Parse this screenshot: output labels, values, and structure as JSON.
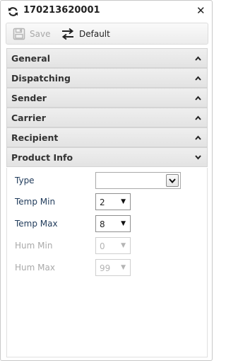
{
  "window": {
    "title": "170213620001"
  },
  "toolbar": {
    "save_label": "Save",
    "default_label": "Default"
  },
  "sections": [
    {
      "label": "General",
      "expanded": false
    },
    {
      "label": "Dispatching",
      "expanded": false
    },
    {
      "label": "Sender",
      "expanded": false
    },
    {
      "label": "Carrier",
      "expanded": false
    },
    {
      "label": "Recipient",
      "expanded": false
    },
    {
      "label": "Product Info",
      "expanded": true
    }
  ],
  "product_info": {
    "type": {
      "label": "Type",
      "value": ""
    },
    "temp_min": {
      "label": "Temp Min",
      "value": "2",
      "enabled": true
    },
    "temp_max": {
      "label": "Temp Max",
      "value": "8",
      "enabled": true
    },
    "hum_min": {
      "label": "Hum Min",
      "value": "0",
      "enabled": false
    },
    "hum_max": {
      "label": "Hum Max",
      "value": "99",
      "enabled": false
    }
  },
  "icons": {
    "refresh": "refresh-icon",
    "close": "close-icon",
    "save": "floppy-disk-icon",
    "default": "swap-arrows-icon",
    "collapsed": "chevron-up-icon",
    "expanded": "chevron-down-icon"
  },
  "colors": {
    "field_label": "#1f3a5a",
    "disabled": "#a9a9a9",
    "section_bg": "#e8e8e8"
  }
}
